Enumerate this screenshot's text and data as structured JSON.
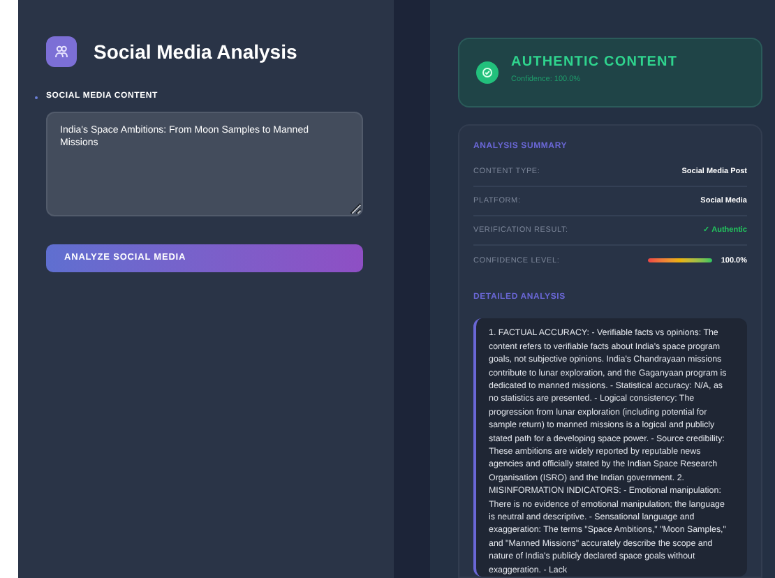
{
  "input_panel": {
    "title": "Social Media Analysis",
    "field_label": "SOCIAL MEDIA CONTENT",
    "content": "India's Space Ambitions: From Moon Samples to Manned Missions",
    "button": "ANALYZE SOCIAL MEDIA"
  },
  "result": {
    "verdict": "AUTHENTIC CONTENT",
    "confidence": "Confidence: 100.0%"
  },
  "summary": {
    "title": "ANALYSIS SUMMARY",
    "rows": [
      {
        "kind": "text",
        "label": "CONTENT TYPE:",
        "value": "Social Media Post"
      },
      {
        "kind": "text",
        "label": "PLATFORM:",
        "value": "Social Media"
      },
      {
        "kind": "status",
        "label": "VERIFICATION RESULT:",
        "value": "✓ Authentic"
      },
      {
        "kind": "meter",
        "label": "CONFIDENCE LEVEL:",
        "value": "100.0%",
        "level": 1.0
      }
    ]
  },
  "details": {
    "title": "DETAILED ANALYSIS",
    "text": "1. FACTUAL ACCURACY: - Verifiable facts vs opinions: The content refers to verifiable facts about India's space program goals, not subjective opinions. India's Chandrayaan missions contribute to lunar exploration, and the Gaganyaan program is dedicated to manned missions. - Statistical accuracy: N/A, as no statistics are presented. - Logical consistency: The progression from lunar exploration (including potential for sample return) to manned missions is a logical and publicly stated path for a developing space power. - Source credibility: These ambitions are widely reported by reputable news agencies and officially stated by the Indian Space Research Organisation (ISRO) and the Indian government. 2. MISINFORMATION INDICATORS: - Emotional manipulation: There is no evidence of emotional manipulation; the language is neutral and descriptive. - Sensational language and exaggeration: The terms \"Space Ambitions,\" \"Moon Samples,\" and \"Manned Missions\" accurately describe the scope and nature of India's publicly declared space goals without exaggeration. - Lack"
  }
}
